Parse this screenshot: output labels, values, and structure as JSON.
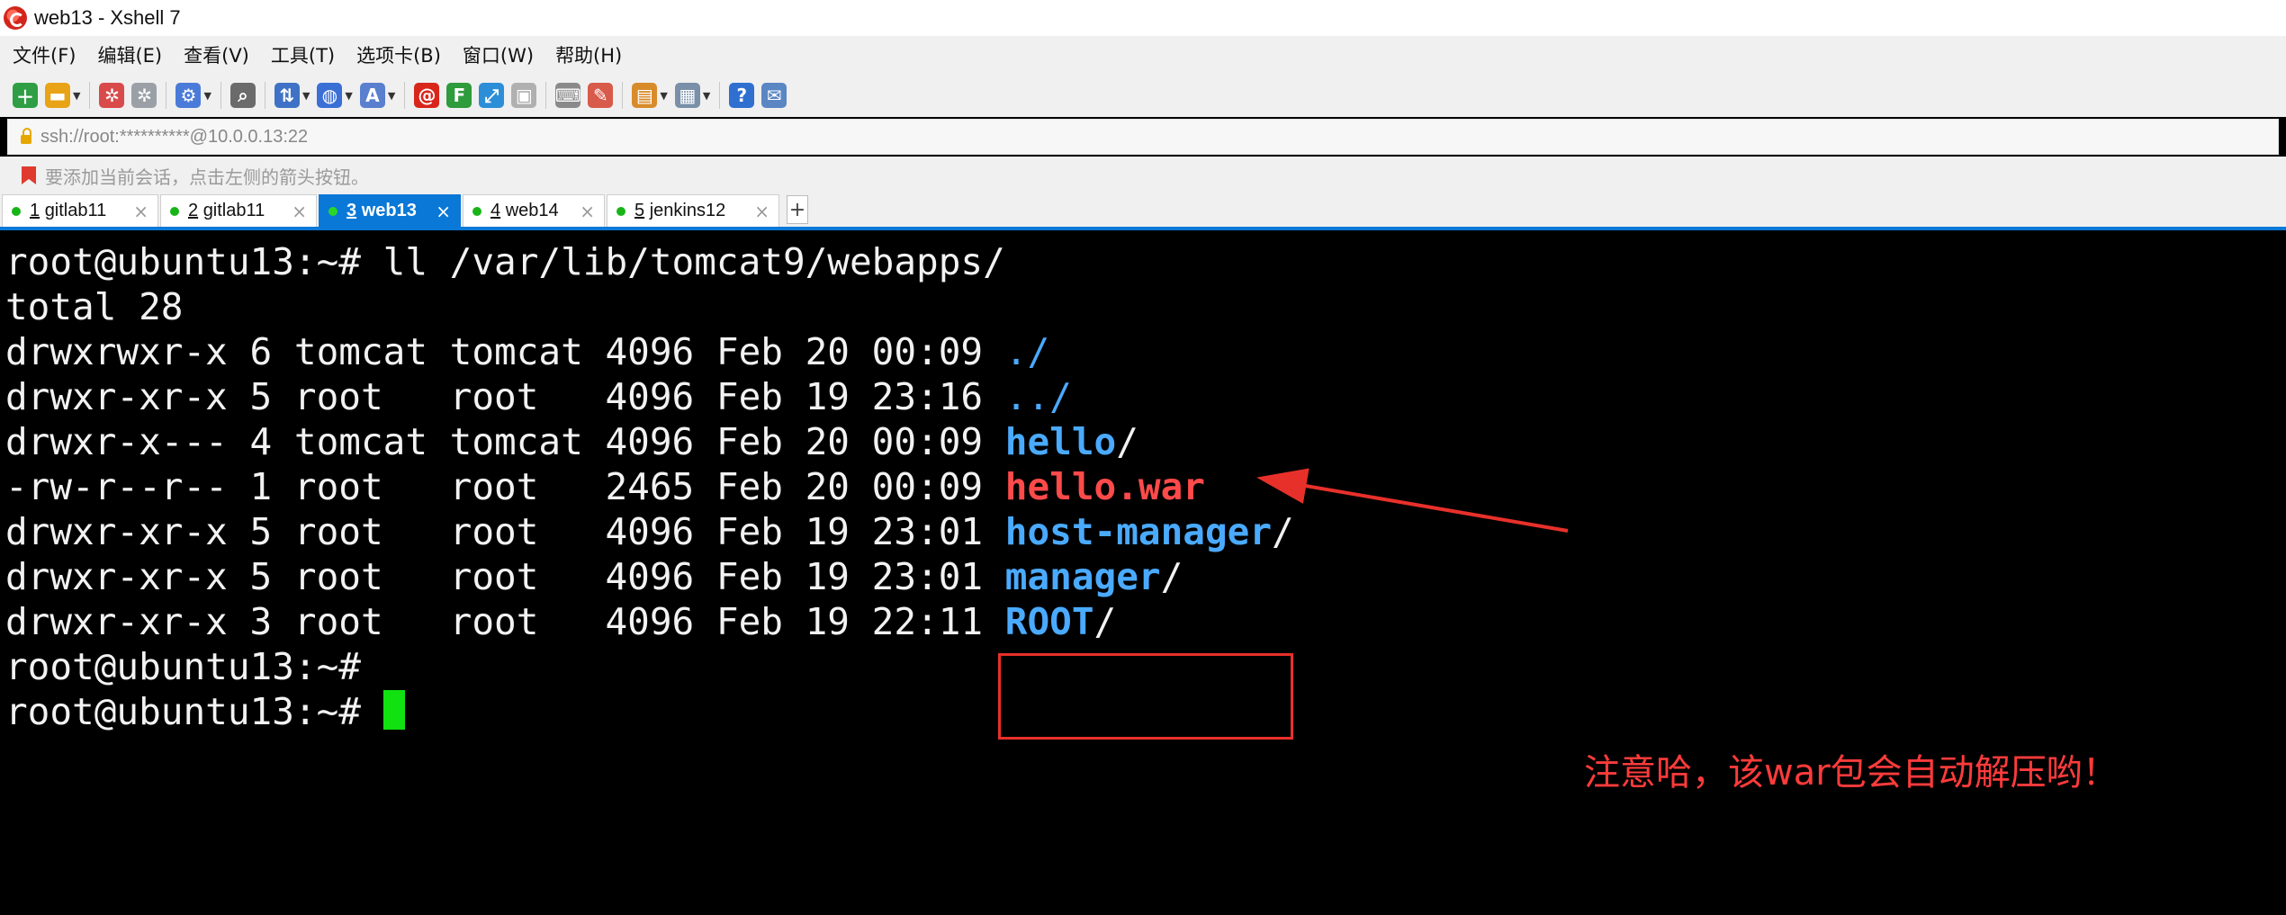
{
  "window": {
    "title": "web13 - Xshell 7"
  },
  "menu": [
    "文件(F)",
    "编辑(E)",
    "查看(V)",
    "工具(T)",
    "选项卡(B)",
    "窗口(W)",
    "帮助(H)"
  ],
  "toolbar": {
    "buttons": [
      {
        "icon": "new-session-icon",
        "color": "#2f9e44",
        "glyph": "＋",
        "drop": false
      },
      {
        "icon": "open-folder-icon",
        "color": "#e8a317",
        "glyph": "▬",
        "drop": true
      },
      {
        "icon": "connect-icon",
        "color": "#d94a4a",
        "glyph": "✲",
        "drop": false
      },
      {
        "icon": "disconnect-icon",
        "color": "#9aa0a6",
        "glyph": "✲",
        "drop": false
      },
      {
        "icon": "properties-icon",
        "color": "#4b7bd8",
        "glyph": "⚙",
        "drop": true
      },
      {
        "icon": "find-icon",
        "color": "#6b6b6b",
        "glyph": "⌕",
        "drop": false
      },
      {
        "icon": "transfer-icon",
        "color": "#3f72c6",
        "glyph": "⇅",
        "drop": true
      },
      {
        "icon": "globe-icon",
        "color": "#3a6fd6",
        "glyph": "◍",
        "drop": true
      },
      {
        "icon": "font-icon",
        "color": "#5a7fcf",
        "glyph": "A",
        "drop": true
      },
      {
        "icon": "xshell-logo-icon",
        "color": "#d8261b",
        "glyph": "@",
        "drop": false
      },
      {
        "icon": "xftp-icon",
        "color": "#2e9b3c",
        "glyph": "F",
        "drop": false
      },
      {
        "icon": "fullscreen-icon",
        "color": "#2d8ed8",
        "glyph": "⤢",
        "drop": false
      },
      {
        "icon": "lock-icon",
        "color": "#b0b0b0",
        "glyph": "▣",
        "drop": false
      },
      {
        "icon": "keyboard-icon",
        "color": "#8a8a8a",
        "glyph": "⌨",
        "drop": false
      },
      {
        "icon": "highlight-icon",
        "color": "#d85a4a",
        "glyph": "✎",
        "drop": false
      },
      {
        "icon": "script-icon",
        "color": "#d88b2a",
        "glyph": "▤",
        "drop": true
      },
      {
        "icon": "layout-icon",
        "color": "#7a8fa8",
        "glyph": "▦",
        "drop": true
      },
      {
        "icon": "help-icon",
        "color": "#2f6fd0",
        "glyph": "?",
        "drop": false
      },
      {
        "icon": "chat-icon",
        "color": "#5a86c4",
        "glyph": "✉",
        "drop": false
      }
    ]
  },
  "address": {
    "text": "ssh://root:**********@10.0.0.13:22"
  },
  "hint": {
    "text": "要添加当前会话，点击左侧的箭头按钮。"
  },
  "tabs": [
    {
      "num": "1",
      "label": "gitlab11",
      "active": false
    },
    {
      "num": "2",
      "label": "gitlab11",
      "active": false
    },
    {
      "num": "3",
      "label": "web13",
      "active": true
    },
    {
      "num": "4",
      "label": "web14",
      "active": false
    },
    {
      "num": "5",
      "label": "jenkins12",
      "active": false
    }
  ],
  "tab_add": "+",
  "tab_close": "×",
  "terminal": {
    "lines": [
      {
        "text": "root@ubuntu13:~# ll /var/lib/tomcat9/webapps/"
      },
      {
        "text": "total 28"
      },
      {
        "perm": "drwxrwxr-x 6 tomcat tomcat 4096 Feb 20 00:09 ",
        "name": "./",
        "kind": "dotdir"
      },
      {
        "perm": "drwxr-xr-x 5 root   root   4096 Feb 19 23:16 ",
        "name": "../",
        "kind": "dotdir"
      },
      {
        "perm": "drwxr-x--- 4 tomcat tomcat 4096 Feb 20 00:09 ",
        "name": "hello",
        "suffix": "/",
        "kind": "dir"
      },
      {
        "perm": "-rw-r--r-- 1 root   root   2465 Feb 20 00:09 ",
        "name": "hello.war",
        "kind": "war"
      },
      {
        "perm": "drwxr-xr-x 5 root   root   4096 Feb 19 23:01 ",
        "name": "host-manager",
        "suffix": "/",
        "kind": "dir"
      },
      {
        "perm": "drwxr-xr-x 5 root   root   4096 Feb 19 23:01 ",
        "name": "manager",
        "suffix": "/",
        "kind": "dir"
      },
      {
        "perm": "drwxr-xr-x 3 root   root   4096 Feb 19 22:11 ",
        "name": "ROOT",
        "suffix": "/",
        "kind": "dir"
      },
      {
        "text": "root@ubuntu13:~#"
      },
      {
        "text": "root@ubuntu13:~# ",
        "cursor": true
      }
    ],
    "annotation": "注意哈，该war包会自动解压哟！"
  }
}
